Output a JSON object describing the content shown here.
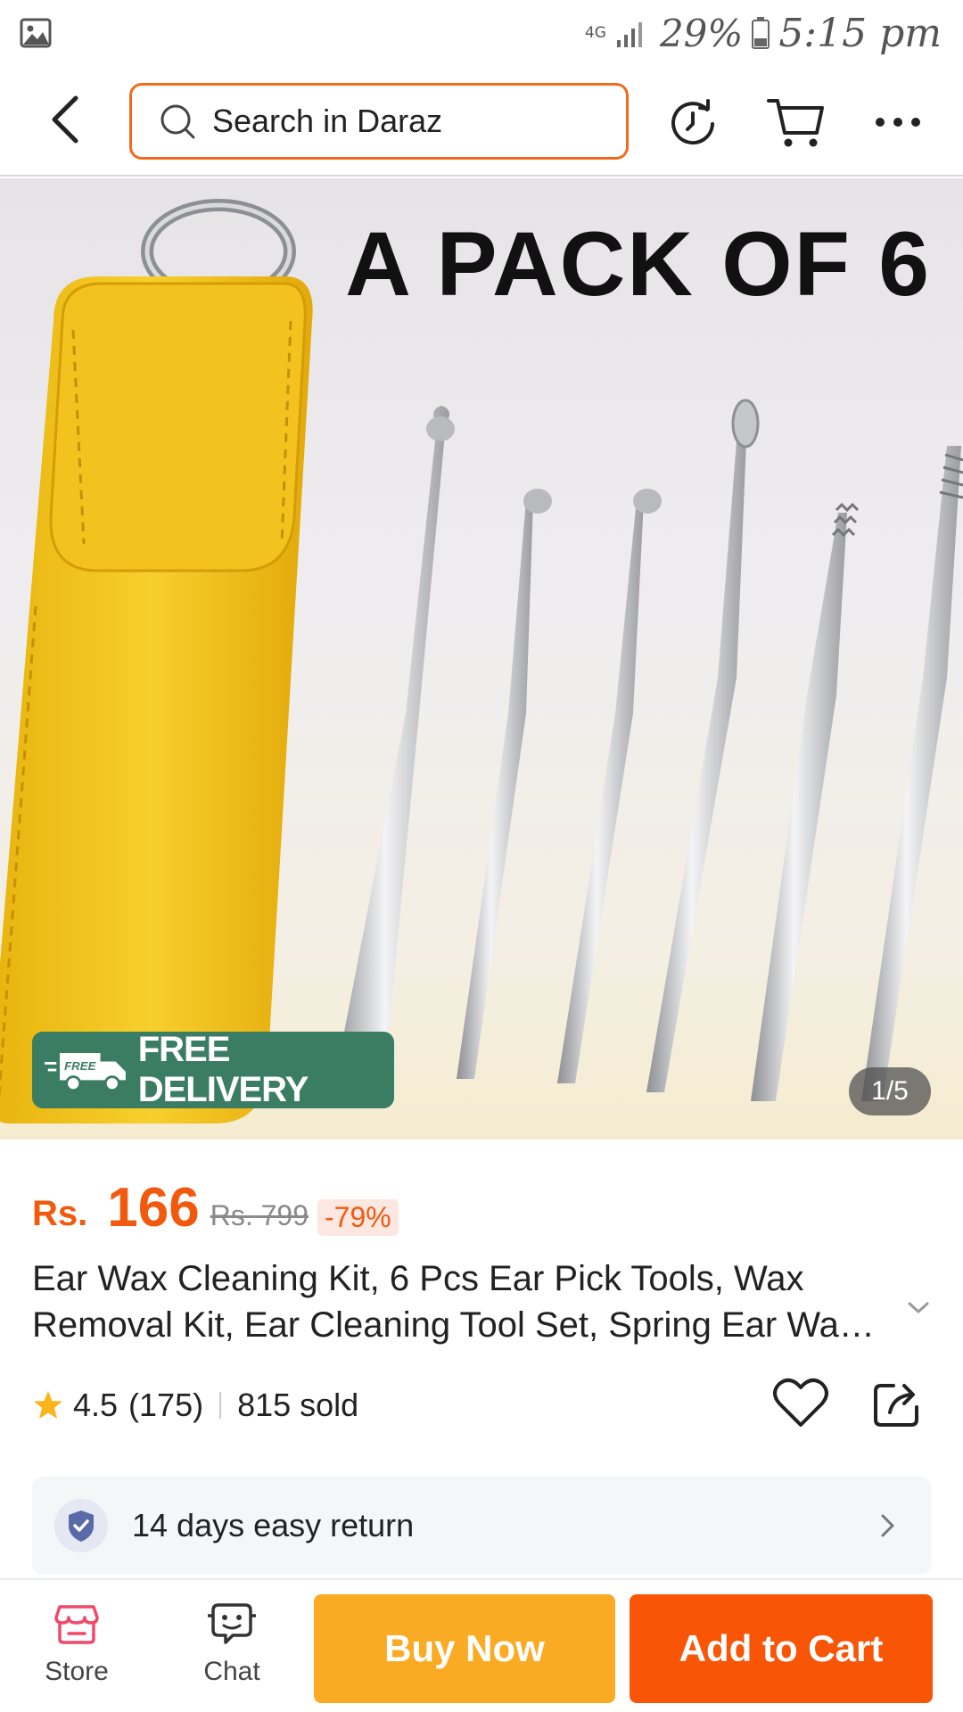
{
  "status_bar": {
    "network": "4G",
    "battery": "29%",
    "time": "5:15 pm"
  },
  "top_nav": {
    "search_placeholder": "Search in Daraz",
    "accent_color": "#f36a1d"
  },
  "gallery": {
    "banner_text": "A PACK  OF 6",
    "free_delivery_label": "FREE DELIVERY",
    "truck_badge_text": "FREE",
    "image_counter": "1/5",
    "badge_color": "#3b7d63"
  },
  "price": {
    "currency": "Rs.",
    "current": "166",
    "original": "Rs. 799",
    "discount": "-79%",
    "color": "#f15a0e"
  },
  "product": {
    "title": "Ear Wax Cleaning Kit, 6 Pcs Ear Pick Tools, Wax Removal Kit, Ear Cleaning Tool Set, Spring Ear Wax Cleaner Tool"
  },
  "rating": {
    "value": "4.5",
    "count": "(175)",
    "sold": "815 sold"
  },
  "return_policy": {
    "text": "14 days easy return"
  },
  "bottom_bar": {
    "store_label": "Store",
    "chat_label": "Chat",
    "buy_now_label": "Buy Now",
    "add_to_cart_label": "Add to Cart",
    "buy_now_color": "#fbab23",
    "add_to_cart_color": "#f85606"
  }
}
